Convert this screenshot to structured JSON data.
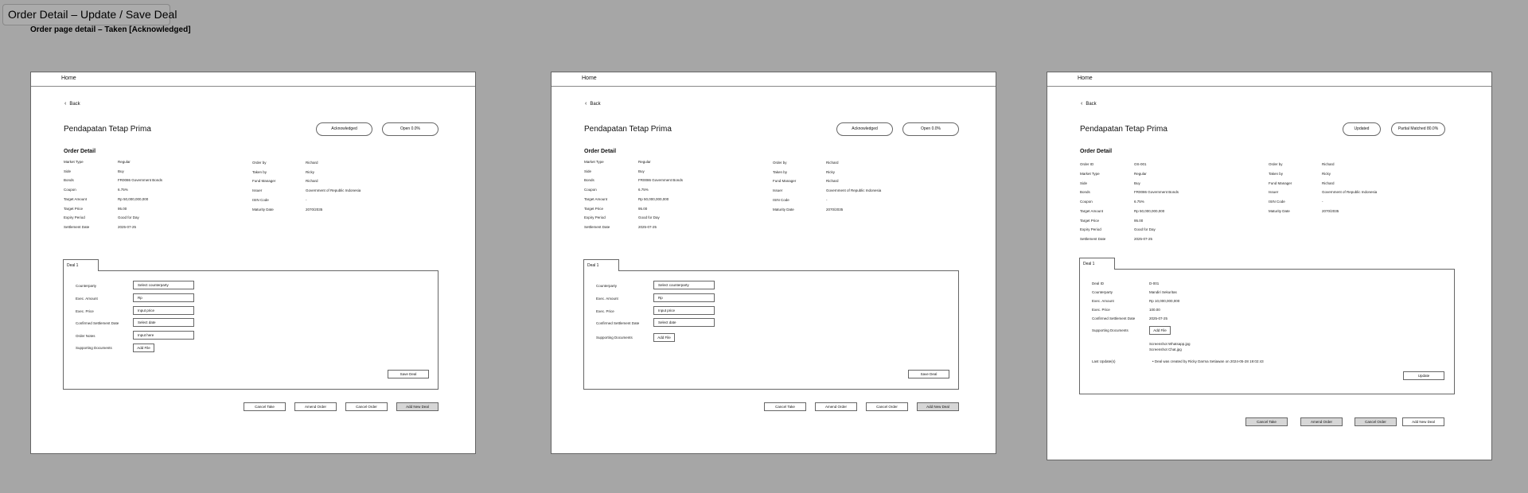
{
  "page": {
    "title": "Order Detail – Update / Save Deal",
    "subtitle": "Order page detail – Taken [Acknowledged]"
  },
  "common": {
    "home": "Home",
    "back": "Back",
    "fund_name": "Pendapatan Tetap Prima",
    "order_detail_title": "Order Detail",
    "deal_tab": "Deal 1"
  },
  "screen1": {
    "status_badge": "Acknowledged",
    "open_badge": "Open 0.0%",
    "details_left": [
      {
        "label": "Market Type",
        "value": "Regular"
      },
      {
        "label": "Side",
        "value": "Buy"
      },
      {
        "label": "Bonds",
        "value": "FR0086 Government Bonds"
      },
      {
        "label": "Coupon",
        "value": "6.75%"
      },
      {
        "label": "Target Amount",
        "value": "Rp 50,000,000,000"
      },
      {
        "label": "Target Price",
        "value": "95.00"
      },
      {
        "label": "Expiry Period",
        "value": "Good for Day"
      },
      {
        "label": "Settlement Date",
        "value": "2025-07-25"
      }
    ],
    "details_right": [
      {
        "label": "Order by",
        "value": "Richard"
      },
      {
        "label": "Taken by",
        "value": "Ricky"
      },
      {
        "label": "Fund Manager",
        "value": "Richard"
      },
      {
        "label": "Issuer",
        "value": "Government of Republic Indonesia"
      },
      {
        "label": "ISIN Code",
        "value": "-"
      },
      {
        "label": "Maturity Date",
        "value": "2070/2035"
      }
    ],
    "deal_fields": [
      {
        "label": "Counterparty",
        "placeholder": "Select counterparty"
      },
      {
        "label": "Exec. Amount",
        "placeholder": "Rp"
      },
      {
        "label": "Exec. Price",
        "placeholder": "Input price"
      },
      {
        "label": "Confirmed Settlement Date",
        "placeholder": "Select date"
      },
      {
        "label": "Order Notes",
        "placeholder": "Input here"
      }
    ],
    "supporting_documents_label": "Supporting Documents",
    "add_file": "Add File",
    "save_deal": "Save Deal",
    "actions": [
      "Cancel Take",
      "Amend Order",
      "Cancel Order",
      "Add New Deal"
    ]
  },
  "screen2": {
    "status_badge": "Acknowledged",
    "open_badge": "Open 0.0%",
    "details_left": [
      {
        "label": "Market Type",
        "value": "Regular"
      },
      {
        "label": "Side",
        "value": "Buy"
      },
      {
        "label": "Bonds",
        "value": "FR0086 Government Bonds"
      },
      {
        "label": "Coupon",
        "value": "6.75%"
      },
      {
        "label": "Target Amount",
        "value": "Rp 50,000,000,000"
      },
      {
        "label": "Target Price",
        "value": "95.00"
      },
      {
        "label": "Expiry Period",
        "value": "Good for Day"
      },
      {
        "label": "Settlement Date",
        "value": "2025-07-25"
      }
    ],
    "details_right": [
      {
        "label": "Order by",
        "value": "Richard"
      },
      {
        "label": "Taken by",
        "value": "Ricky"
      },
      {
        "label": "Fund Manager",
        "value": "Richard"
      },
      {
        "label": "Issuer",
        "value": "Government of Republic Indonesia"
      },
      {
        "label": "ISIN Code",
        "value": "-"
      },
      {
        "label": "Maturity Date",
        "value": "2070/2035"
      }
    ],
    "deal_fields": [
      {
        "label": "Counterparty",
        "placeholder": "Select counterparty"
      },
      {
        "label": "Exec. Amount",
        "placeholder": "Rp"
      },
      {
        "label": "Exec. Price",
        "placeholder": "Input price"
      },
      {
        "label": "Confirmed Settlement Date",
        "placeholder": "Select date"
      }
    ],
    "supporting_documents_label": "Supporting Documents",
    "add_file": "Add File",
    "save_deal": "Save Deal",
    "actions": [
      "Cancel Take",
      "Amend Order",
      "Cancel Order",
      "Add New Deal"
    ]
  },
  "screen3": {
    "status_badge": "Updated",
    "open_badge": "Partial Matched 80.0%",
    "details_left": [
      {
        "label": "Order ID",
        "value": "OS-001"
      },
      {
        "label": "Market Type",
        "value": "Regular"
      },
      {
        "label": "Side",
        "value": "Buy"
      },
      {
        "label": "Bonds",
        "value": "FR0086 Government Bonds"
      },
      {
        "label": "Coupon",
        "value": "6.75%"
      },
      {
        "label": "Target Amount",
        "value": "Rp 50,000,000,000"
      },
      {
        "label": "Target Price",
        "value": "95.00"
      },
      {
        "label": "Expiry Period",
        "value": "Good for Day"
      },
      {
        "label": "Settlement Date",
        "value": "2025-07-25"
      }
    ],
    "details_right": [
      {
        "label": "Order by",
        "value": "Richard"
      },
      {
        "label": "Taken by",
        "value": "Ricky"
      },
      {
        "label": "Fund Manager",
        "value": "Richard"
      },
      {
        "label": "Issuer",
        "value": "Government of Republic Indonesia"
      },
      {
        "label": "ISIN Code",
        "value": "-"
      },
      {
        "label": "Maturity Date",
        "value": "2070/2035"
      }
    ],
    "deal_fields": [
      {
        "label": "Deal ID",
        "value": "D-001"
      },
      {
        "label": "Counterparty",
        "value": "Mandiri Sekuritas"
      },
      {
        "label": "Exec. Amount",
        "value": "Rp 10,000,000,000"
      },
      {
        "label": "Exec. Price",
        "value": "100.00"
      },
      {
        "label": "Confirmed Settlement Date",
        "value": "2025-07-25"
      }
    ],
    "supporting_documents_label": "Supporting Documents",
    "add_file": "Add File",
    "files": [
      "Screenshot Whatsapp.jpg",
      "Screenshot Chat.jpg"
    ],
    "last_updates_label": "Last Update(s)",
    "last_update_entry": "• Deal was created by Ricky Darma Setiawan on 2024-05-28 19:02:43",
    "update_button": "Update",
    "actions": [
      "Cancel Take",
      "Amend Order",
      "Cancel Order",
      "Add New Deal"
    ]
  }
}
